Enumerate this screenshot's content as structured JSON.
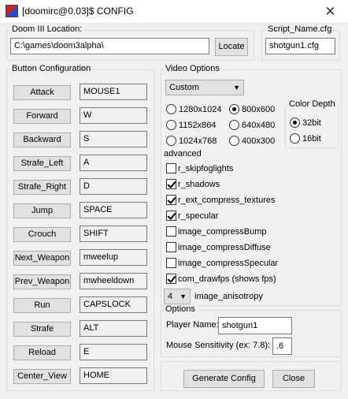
{
  "window": {
    "title": "[doomirc@0.03]$ CONFIG",
    "close_glyph": "✕"
  },
  "location": {
    "group_label": "Doom III Location:",
    "path_value": "C:\\games\\doom3alpha\\",
    "locate_label": "Locate"
  },
  "script": {
    "group_label": "Script_Name.cfg",
    "value": "shotgun1.cfg"
  },
  "buttons": {
    "group_label": "Button Configuration",
    "rows": [
      {
        "action": "Attack",
        "key": "MOUSE1"
      },
      {
        "action": "Forward",
        "key": "W"
      },
      {
        "action": "Backward",
        "key": "S"
      },
      {
        "action": "Strafe_Left",
        "key": "A"
      },
      {
        "action": "Strafe_Right",
        "key": "D"
      },
      {
        "action": "Jump",
        "key": "SPACE"
      },
      {
        "action": "Crouch",
        "key": "SHIFT"
      },
      {
        "action": "Next_Weapon",
        "key": "mweelup"
      },
      {
        "action": "Prev_Weapon",
        "key": "mwheeldown"
      },
      {
        "action": "Run",
        "key": "CAPSLOCK"
      },
      {
        "action": "Strafe",
        "key": "ALT"
      },
      {
        "action": "Reload",
        "key": "E"
      },
      {
        "action": "Center_View",
        "key": "HOME"
      }
    ]
  },
  "video": {
    "group_label": "Video Options",
    "preset_value": "Custom",
    "resolutions": [
      {
        "label": "1280x1024",
        "selected": false
      },
      {
        "label": "800x600",
        "selected": true
      },
      {
        "label": "1152x864",
        "selected": false
      },
      {
        "label": "640x480",
        "selected": false
      },
      {
        "label": "1024x768",
        "selected": false
      },
      {
        "label": "400x300",
        "selected": false
      }
    ],
    "color_depth": {
      "label": "Color Depth",
      "options": [
        {
          "label": "32bit",
          "selected": true
        },
        {
          "label": "16bit",
          "selected": false
        }
      ]
    }
  },
  "advanced": {
    "label": "advanced",
    "checks": [
      {
        "label": "r_skipfoglights",
        "checked": false
      },
      {
        "label": "r_shadows",
        "checked": true
      },
      {
        "label": "r_ext_compress_textures",
        "checked": true
      },
      {
        "label": "r_specular",
        "checked": true
      },
      {
        "label": "image_compressBump",
        "checked": false
      },
      {
        "label": "image_compressDiffuse",
        "checked": false
      },
      {
        "label": "image_compressSpecular",
        "checked": false
      },
      {
        "label": "com_drawfps (shows fps)",
        "checked": true
      }
    ],
    "anisotropy_value": "4",
    "anisotropy_label": "image_anisotropy"
  },
  "options": {
    "group_label": "Options",
    "player_name_label": "Player Name:",
    "player_name_value": "shotgun1",
    "sensitivity_label": "Mouse Sensitivity (ex: 7.8):",
    "sensitivity_value": ".6"
  },
  "actions": {
    "generate_label": "Generate Config",
    "close_label": "Close"
  }
}
